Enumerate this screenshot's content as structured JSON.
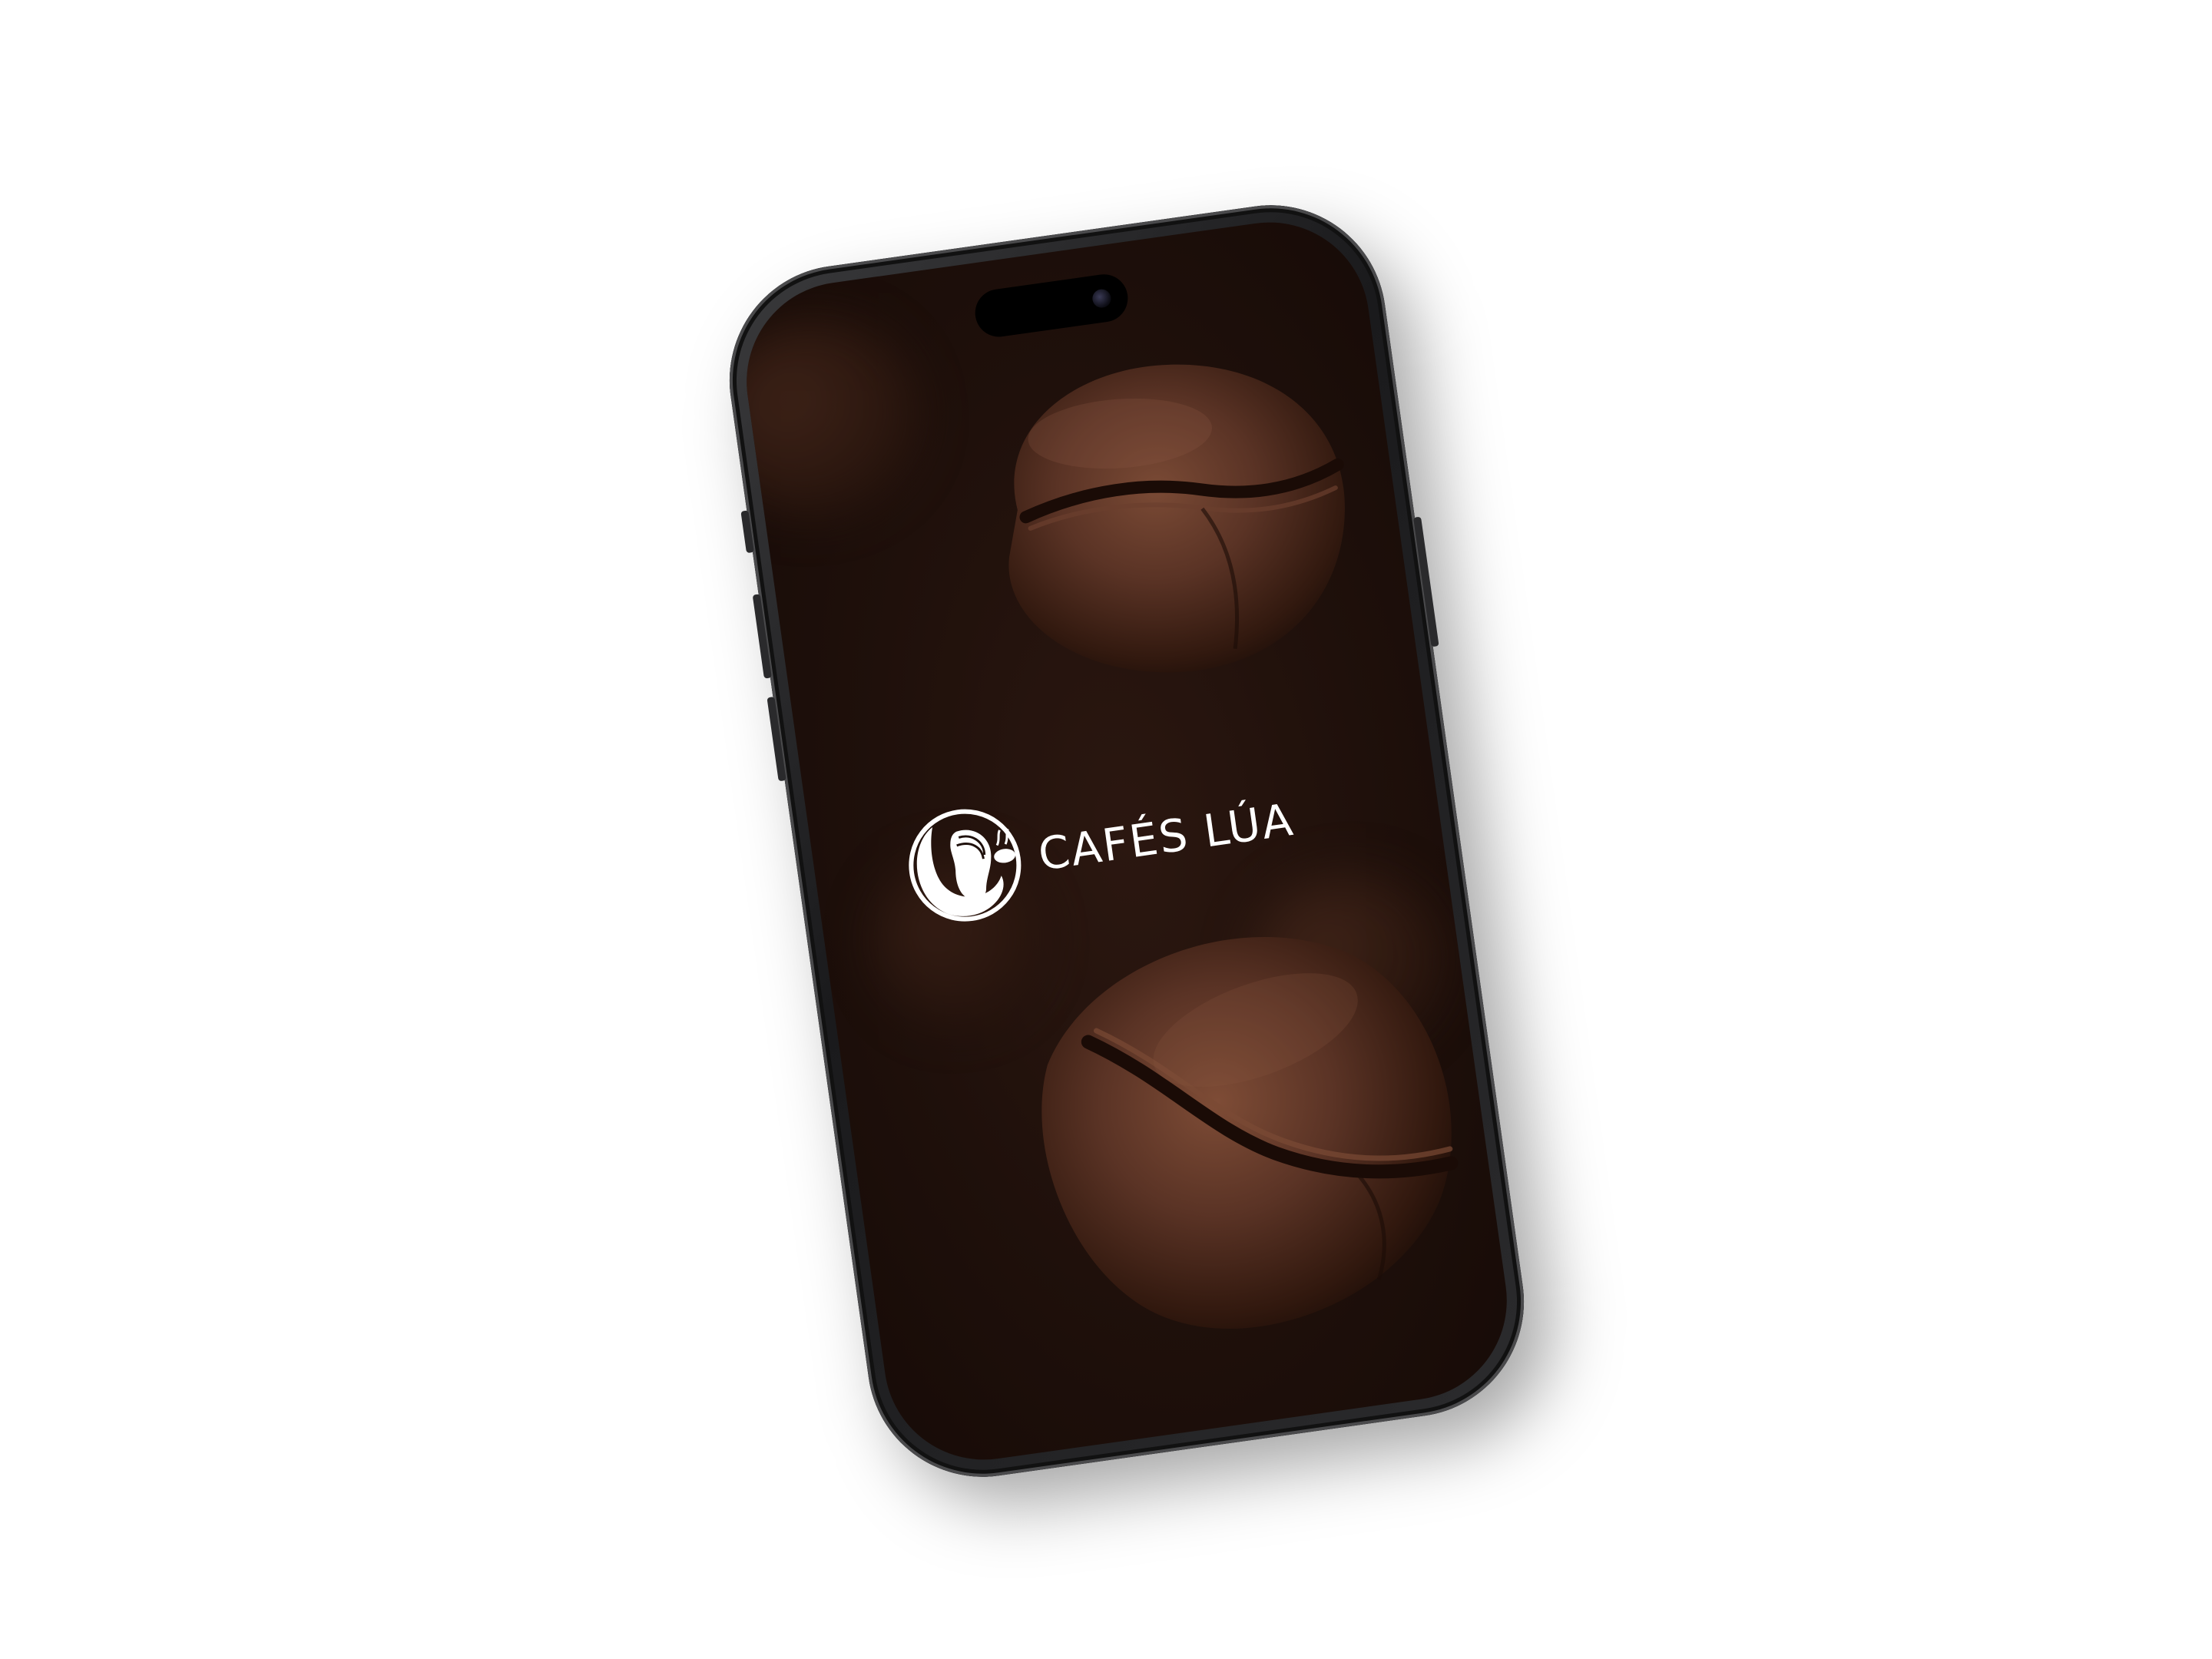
{
  "app": {
    "brand_name": "CAFÉS LÚA",
    "logo_icon": "woman-profile-crescent-moon-coffee-cup-logo"
  },
  "device": {
    "type": "phone",
    "frame_color": "#2b2b2d"
  },
  "colors": {
    "background": "#ffffff",
    "screen_background": "#1f100b",
    "bean_color": "#5a3325",
    "brand_text": "#ffffff"
  }
}
